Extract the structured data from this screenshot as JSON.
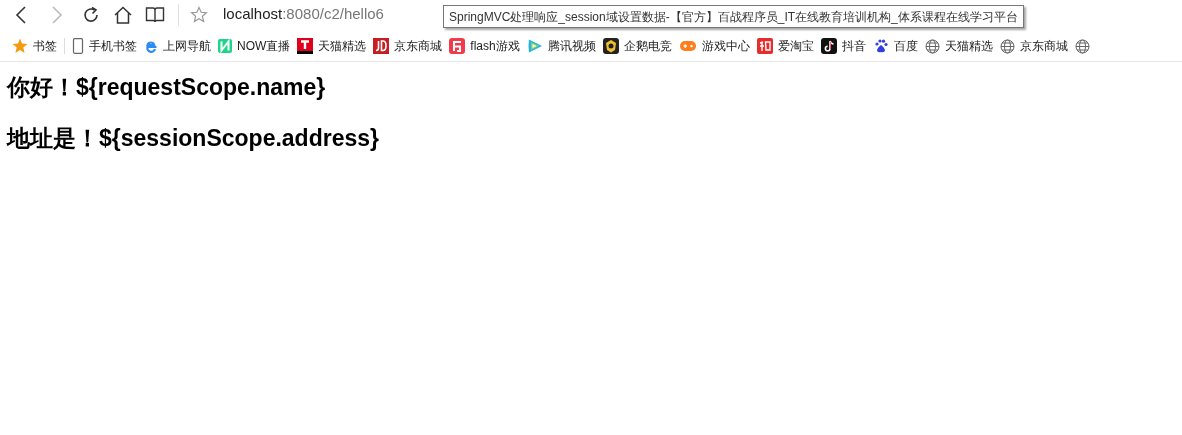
{
  "toolbar": {
    "url_host": "localhost",
    "url_path": ":8080/c2/hello6",
    "back_disabled": false,
    "forward_disabled": true
  },
  "tooltip": {
    "text": "SpringMVC处理响应_session域设置数据-【官方】百战程序员_IT在线教育培训机构_体系课程在线学习平台"
  },
  "bookmarks": [
    {
      "kind": "star",
      "label": "书签"
    },
    {
      "kind": "phone",
      "label": "手机书签"
    },
    {
      "kind": "ie",
      "label": "上网导航"
    },
    {
      "kind": "now",
      "label": "NOW直播"
    },
    {
      "kind": "tmall",
      "label": "天猫精选"
    },
    {
      "kind": "jd",
      "label": "京东商城"
    },
    {
      "kind": "flash",
      "label": "flash游戏"
    },
    {
      "kind": "video",
      "label": "腾讯视频"
    },
    {
      "kind": "penguin",
      "label": "企鹅电竞"
    },
    {
      "kind": "game",
      "label": "游戏中心"
    },
    {
      "kind": "taobao",
      "label": "爱淘宝"
    },
    {
      "kind": "tiktok",
      "label": "抖音"
    },
    {
      "kind": "baidu",
      "label": "百度"
    },
    {
      "kind": "globe",
      "label": "天猫精选"
    },
    {
      "kind": "globe",
      "label": "京东商城"
    },
    {
      "kind": "globe"
    }
  ],
  "page": {
    "headings": [
      "你好！${requestScope.name}",
      "地址是！${sessionScope.address}"
    ]
  }
}
